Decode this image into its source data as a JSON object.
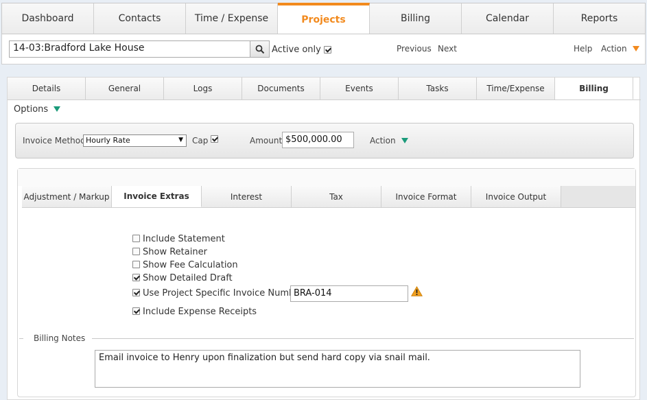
{
  "topnav": {
    "tabs": [
      "Dashboard",
      "Contacts",
      "Time / Expense",
      "Projects",
      "Billing",
      "Calendar",
      "Reports"
    ],
    "active": "Projects"
  },
  "searchbar": {
    "project_value": "14-03:Bradford Lake House",
    "active_only_label": "Active only",
    "active_only_checked": true,
    "previous_label": "Previous",
    "next_label": "Next",
    "help_label": "Help",
    "action_label": "Action"
  },
  "subtabs": {
    "tabs": [
      "Details",
      "General",
      "Logs",
      "Documents",
      "Events",
      "Tasks",
      "Time/Expense",
      "Billing"
    ],
    "active": "Billing"
  },
  "options_label": "Options",
  "method_bar": {
    "invoice_method_label": "Invoice Method",
    "invoice_method_value": "Hourly Rate",
    "cap_label": "Cap",
    "cap_checked": true,
    "amount_label": "Amount",
    "amount_value": "$500,000.00",
    "action_label": "Action"
  },
  "inner_tabs": {
    "tabs": [
      "Adjustment / Markup",
      "Invoice Extras",
      "Interest",
      "Tax",
      "Invoice Format",
      "Invoice Output"
    ],
    "active": "Invoice Extras"
  },
  "invoice_extras": {
    "options": [
      {
        "label": "Include Statement",
        "checked": false
      },
      {
        "label": "Show Retainer",
        "checked": false
      },
      {
        "label": "Show Fee Calculation",
        "checked": false
      },
      {
        "label": "Show Detailed Draft",
        "checked": true
      },
      {
        "label": "Use Project Specific Invoice Number",
        "checked": true
      },
      {
        "label": "Include Expense Receipts",
        "checked": true
      }
    ],
    "invoice_number_value": "BRA-014"
  },
  "billing_notes": {
    "label": "Billing Notes",
    "text": "Email invoice to Henry upon finalization but send hard copy via snail mail."
  },
  "colors": {
    "accent_orange": "#f28a1e",
    "accent_green": "#1a9a7a",
    "warning": "#f0a020"
  }
}
